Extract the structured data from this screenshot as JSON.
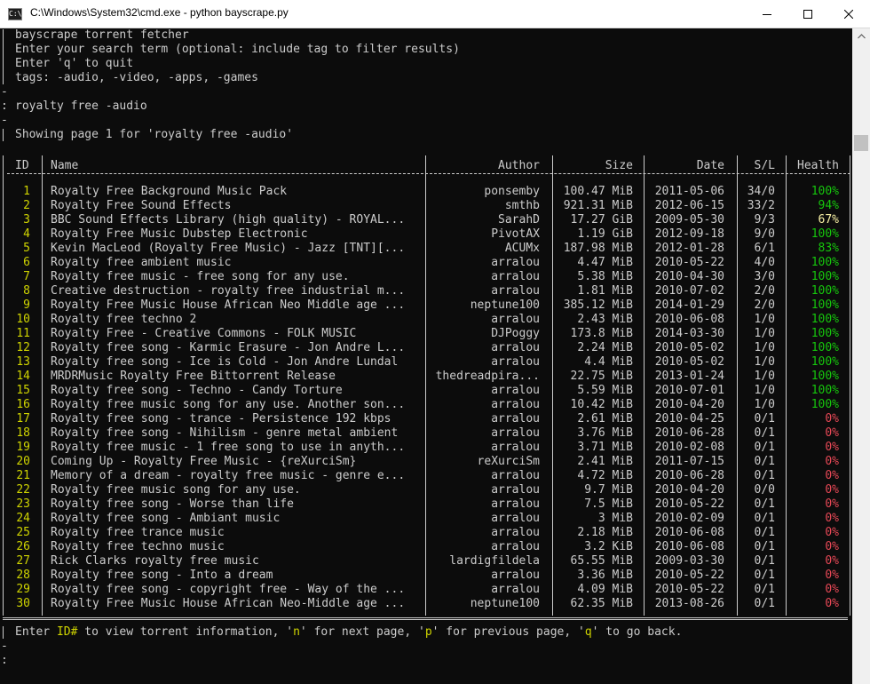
{
  "window": {
    "title": "C:\\Windows\\System32\\cmd.exe - python  bayscrape.py",
    "icon_label": "C:\\"
  },
  "intro": [
    "bayscrape torrent fetcher",
    "Enter your search term (optional: include tag to filter results)",
    "Enter 'q' to quit",
    "tags: -audio, -video, -apps, -games"
  ],
  "prompt": {
    "dash": "-",
    "prefix": ": ",
    "query": "royalty free -audio"
  },
  "showing": "Showing page 1 for 'royalty free -audio'",
  "columns": {
    "id": "ID",
    "name": "Name",
    "author": "Author",
    "size": "Size",
    "date": "Date",
    "sl": "S/L",
    "health": "Health"
  },
  "colors": {
    "health_good": "#16c60c",
    "health_mid": "#f9f1a5",
    "health_bad": "#e74856",
    "id": "#cfd400",
    "text": "#cccccc"
  },
  "rows": [
    {
      "id": "1",
      "name": "Royalty Free Background Music Pack",
      "author": "ponsemby",
      "size": "100.47 MiB",
      "date": "2011-05-06",
      "sl": "34/0",
      "health": "100%",
      "hcolor": "#16c60c"
    },
    {
      "id": "2",
      "name": "Royalty Free Sound Effects",
      "author": "smthb",
      "size": "921.31 MiB",
      "date": "2012-06-15",
      "sl": "33/2",
      "health": "94%",
      "hcolor": "#16c60c"
    },
    {
      "id": "3",
      "name": "BBC Sound Effects Library (high quality) - ROYAL...",
      "author": "SarahD",
      "size": "17.27 GiB",
      "date": "2009-05-30",
      "sl": "9/3",
      "health": "67%",
      "hcolor": "#f9f1a5"
    },
    {
      "id": "4",
      "name": "Royalty Free Music Dubstep Electronic",
      "author": "PivotAX",
      "size": "1.19 GiB",
      "date": "2012-09-18",
      "sl": "9/0",
      "health": "100%",
      "hcolor": "#16c60c"
    },
    {
      "id": "5",
      "name": "Kevin MacLeod (Royalty Free Music) - Jazz [TNT][...",
      "author": "ACUMx",
      "size": "187.98 MiB",
      "date": "2012-01-28",
      "sl": "6/1",
      "health": "83%",
      "hcolor": "#16c60c"
    },
    {
      "id": "6",
      "name": "Royalty free ambient music",
      "author": "arralou",
      "size": "4.47 MiB",
      "date": "2010-05-22",
      "sl": "4/0",
      "health": "100%",
      "hcolor": "#16c60c"
    },
    {
      "id": "7",
      "name": "Royalty free music - free song for any use.",
      "author": "arralou",
      "size": "5.38 MiB",
      "date": "2010-04-30",
      "sl": "3/0",
      "health": "100%",
      "hcolor": "#16c60c"
    },
    {
      "id": "8",
      "name": "Creative destruction - royalty free industrial m...",
      "author": "arralou",
      "size": "1.81 MiB",
      "date": "2010-07-02",
      "sl": "2/0",
      "health": "100%",
      "hcolor": "#16c60c"
    },
    {
      "id": "9",
      "name": "Royalty Free Music House African Neo Middle age ...",
      "author": "neptune100",
      "size": "385.12 MiB",
      "date": "2014-01-29",
      "sl": "2/0",
      "health": "100%",
      "hcolor": "#16c60c"
    },
    {
      "id": "10",
      "name": "Royalty free techno 2",
      "author": "arralou",
      "size": "2.43 MiB",
      "date": "2010-06-08",
      "sl": "1/0",
      "health": "100%",
      "hcolor": "#16c60c"
    },
    {
      "id": "11",
      "name": "Royalty Free - Creative Commons - FOLK MUSIC",
      "author": "DJPoggy",
      "size": "173.8 MiB",
      "date": "2014-03-30",
      "sl": "1/0",
      "health": "100%",
      "hcolor": "#16c60c"
    },
    {
      "id": "12",
      "name": "Royalty free song - Karmic Erasure - Jon Andre L...",
      "author": "arralou",
      "size": "2.24 MiB",
      "date": "2010-05-02",
      "sl": "1/0",
      "health": "100%",
      "hcolor": "#16c60c"
    },
    {
      "id": "13",
      "name": "Royalty free song - Ice is Cold - Jon Andre Lundal",
      "author": "arralou",
      "size": "4.4 MiB",
      "date": "2010-05-02",
      "sl": "1/0",
      "health": "100%",
      "hcolor": "#16c60c"
    },
    {
      "id": "14",
      "name": "MRDRMusic Royalty Free Bittorrent Release",
      "author": "thedreadpira...",
      "size": "22.75 MiB",
      "date": "2013-01-24",
      "sl": "1/0",
      "health": "100%",
      "hcolor": "#16c60c"
    },
    {
      "id": "15",
      "name": "Royalty free song - Techno - Candy Torture",
      "author": "arralou",
      "size": "5.59 MiB",
      "date": "2010-07-01",
      "sl": "1/0",
      "health": "100%",
      "hcolor": "#16c60c"
    },
    {
      "id": "16",
      "name": "Royalty free music song for any use. Another son...",
      "author": "arralou",
      "size": "10.42 MiB",
      "date": "2010-04-20",
      "sl": "1/0",
      "health": "100%",
      "hcolor": "#16c60c"
    },
    {
      "id": "17",
      "name": "Royalty free song - trance - Persistence 192 kbps",
      "author": "arralou",
      "size": "2.61 MiB",
      "date": "2010-04-25",
      "sl": "0/1",
      "health": "0%",
      "hcolor": "#e74856"
    },
    {
      "id": "18",
      "name": "Royalty free song - Nihilism - genre metal ambient",
      "author": "arralou",
      "size": "3.76 MiB",
      "date": "2010-06-28",
      "sl": "0/1",
      "health": "0%",
      "hcolor": "#e74856"
    },
    {
      "id": "19",
      "name": "Royalty free music - 1 free song to use in anyth...",
      "author": "arralou",
      "size": "3.71 MiB",
      "date": "2010-02-08",
      "sl": "0/1",
      "health": "0%",
      "hcolor": "#e74856"
    },
    {
      "id": "20",
      "name": "Coming Up - Royalty Free Music - {reXurciSm}",
      "author": "reXurciSm",
      "size": "2.41 MiB",
      "date": "2011-07-15",
      "sl": "0/1",
      "health": "0%",
      "hcolor": "#e74856"
    },
    {
      "id": "21",
      "name": "Memory of a dream - royalty free music - genre e...",
      "author": "arralou",
      "size": "4.72 MiB",
      "date": "2010-06-28",
      "sl": "0/1",
      "health": "0%",
      "hcolor": "#e74856"
    },
    {
      "id": "22",
      "name": "Royalty free music song for any use.",
      "author": "arralou",
      "size": "9.7 MiB",
      "date": "2010-04-20",
      "sl": "0/0",
      "health": "0%",
      "hcolor": "#e74856"
    },
    {
      "id": "23",
      "name": "Royalty free song - Worse than life",
      "author": "arralou",
      "size": "7.5 MiB",
      "date": "2010-05-22",
      "sl": "0/1",
      "health": "0%",
      "hcolor": "#e74856"
    },
    {
      "id": "24",
      "name": "Royalty free song - Ambiant music",
      "author": "arralou",
      "size": "3 MiB",
      "date": "2010-02-09",
      "sl": "0/1",
      "health": "0%",
      "hcolor": "#e74856"
    },
    {
      "id": "25",
      "name": "Royalty free trance music",
      "author": "arralou",
      "size": "2.18 MiB",
      "date": "2010-06-08",
      "sl": "0/1",
      "health": "0%",
      "hcolor": "#e74856"
    },
    {
      "id": "26",
      "name": "Royalty free techno music",
      "author": "arralou",
      "size": "3.2 KiB",
      "date": "2010-06-08",
      "sl": "0/1",
      "health": "0%",
      "hcolor": "#e74856"
    },
    {
      "id": "27",
      "name": "Rick Clarks royalty free music",
      "author": "lardigfildela",
      "size": "65.55 MiB",
      "date": "2009-03-30",
      "sl": "0/1",
      "health": "0%",
      "hcolor": "#e74856"
    },
    {
      "id": "28",
      "name": "Royalty free song - Into a dream",
      "author": "arralou",
      "size": "3.36 MiB",
      "date": "2010-05-22",
      "sl": "0/1",
      "health": "0%",
      "hcolor": "#e74856"
    },
    {
      "id": "29",
      "name": "Royalty free song - copyright free - Way of the ...",
      "author": "arralou",
      "size": "4.09 MiB",
      "date": "2010-05-22",
      "sl": "0/1",
      "health": "0%",
      "hcolor": "#e74856"
    },
    {
      "id": "30",
      "name": "Royalty Free Music House African Neo-Middle age ...",
      "author": "neptune100",
      "size": "62.35 MiB",
      "date": "2013-08-26",
      "sl": "0/1",
      "health": "0%",
      "hcolor": "#e74856"
    }
  ],
  "footer": {
    "enter": "Enter ",
    "id_hash": "ID#",
    "t1": " to view torrent information, '",
    "n": "n",
    "t2": "' for next page, '",
    "p": "p",
    "t3": "' for previous page, '",
    "q": "q",
    "t4": "' to go back.",
    "dash": "-",
    "colon": ":"
  }
}
